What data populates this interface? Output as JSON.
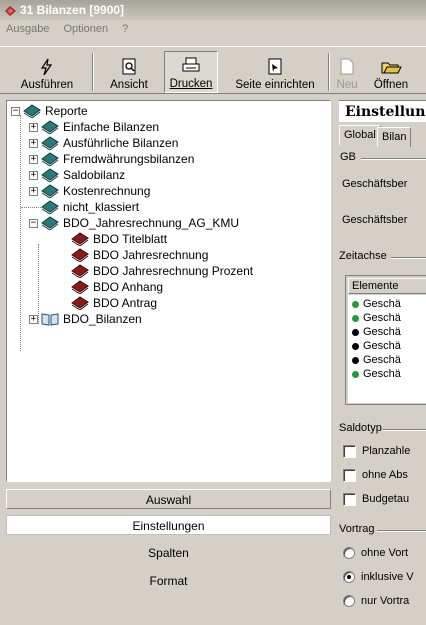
{
  "window": {
    "title": "31 Bilanzen [9900]"
  },
  "menu": [
    "Ausgabe",
    "Optionen",
    "?"
  ],
  "toolbar": {
    "run": "Ausführen",
    "view": "Ansicht",
    "print": "Drucken",
    "page_setup": "Seite einrichten",
    "new": "Neu",
    "open": "Öffnen"
  },
  "tree": {
    "root": "Reporte",
    "items": [
      "Einfache Bilanzen",
      "Ausführliche Bilanzen",
      "Fremdwährungsbilanzen",
      "Saldobilanz",
      "Kostenrechnung",
      "nicht_klassiert",
      "BDO_Jahresrechnung_AG_KMU"
    ],
    "sub_items": [
      "BDO Titelblatt",
      "BDO Jahresrechnung",
      "BDO Jahresrechnung Prozent",
      "BDO Anhang",
      "BDO Antrag"
    ],
    "last": "BDO_Bilanzen"
  },
  "nav": {
    "header": "Auswahl",
    "items": [
      "Einstellungen",
      "Spalten",
      "Format"
    ],
    "selected_index": 0
  },
  "settings": {
    "title": "Einstellun",
    "tabs": [
      "Global",
      "Bilan"
    ],
    "gb": "GB",
    "gb_row1": "Geschäftsber",
    "gb_row2": "Geschäftsber",
    "zeitachse": "Zeitachse",
    "list_header": "Elemente",
    "list_items": [
      {
        "label": "Geschä",
        "color": "#1f9d3a"
      },
      {
        "label": "Geschä",
        "color": "#1f9d3a"
      },
      {
        "label": "Geschä",
        "color": "#000000"
      },
      {
        "label": "Geschä",
        "color": "#000000"
      },
      {
        "label": "Geschä",
        "color": "#000000"
      },
      {
        "label": "Geschä",
        "color": "#1f9d3a"
      }
    ],
    "saldotyp": "Saldotyp",
    "checks": [
      "Planzahle",
      "ohne Abs",
      "Budgetau"
    ],
    "vortrag": "Vortrag",
    "radios": [
      "ohne Vort",
      "inklusive V",
      "nur Vortra"
    ],
    "radio_selected": 1
  },
  "colors": {
    "tree_book": "#2a7a7a",
    "tree_book_sub": "#8b1a1a"
  }
}
